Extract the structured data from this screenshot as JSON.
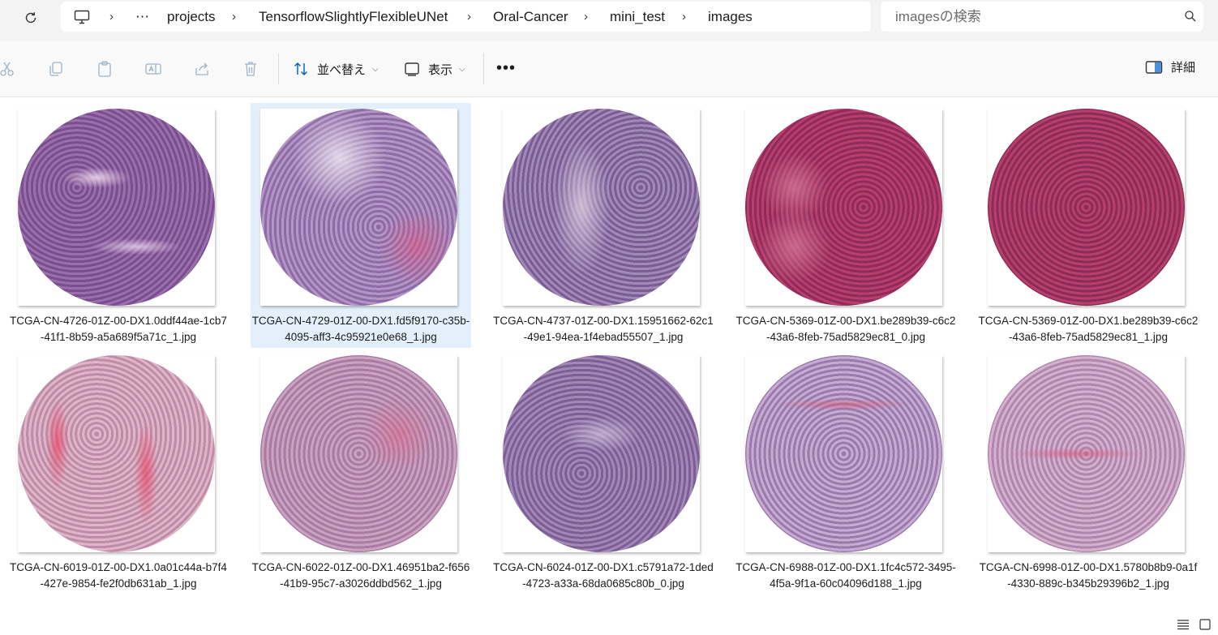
{
  "address_bar": {
    "breadcrumb": [
      {
        "label": "projects"
      },
      {
        "label": "TensorflowSlightlyFlexibleUNet"
      },
      {
        "label": "Oral-Cancer"
      },
      {
        "label": "mini_test"
      },
      {
        "label": "images"
      }
    ],
    "overflow": "⋯",
    "separator": "›"
  },
  "search": {
    "placeholder": "imagesの検索"
  },
  "toolbar": {
    "sort_label": "並べ替え",
    "view_label": "表示",
    "more": "•••",
    "details_label": "詳細"
  },
  "files": [
    {
      "name": "TCGA-CN-4726-01Z-00-DX1.0ddf44ae-1cb7-41f1-8b59-a5a689f5a71c_1.jpg",
      "selected": false
    },
    {
      "name": "TCGA-CN-4729-01Z-00-DX1.fd5f9170-c35b-4095-aff3-4c95921e0e68_1.jpg",
      "selected": true
    },
    {
      "name": "TCGA-CN-4737-01Z-00-DX1.15951662-62c1-49e1-94ea-1f4ebad55507_1.jpg",
      "selected": false
    },
    {
      "name": "TCGA-CN-5369-01Z-00-DX1.be289b39-c6c2-43a6-8feb-75ad5829ec81_0.jpg",
      "selected": false
    },
    {
      "name": "TCGA-CN-5369-01Z-00-DX1.be289b39-c6c2-43a6-8feb-75ad5829ec81_1.jpg",
      "selected": false
    },
    {
      "name": "TCGA-CN-6019-01Z-00-DX1.0a01c44a-b7f4-427e-9854-fe2f0db631ab_1.jpg",
      "selected": false
    },
    {
      "name": "TCGA-CN-6022-01Z-00-DX1.46951ba2-f656-41b9-95c7-a3026ddbd562_1.jpg",
      "selected": false
    },
    {
      "name": "TCGA-CN-6024-01Z-00-DX1.c5791a72-1ded-4723-a33a-68da0685c80b_0.jpg",
      "selected": false
    },
    {
      "name": "TCGA-CN-6988-01Z-00-DX1.1fc4c572-3495-4f5a-9f1a-60c04096d188_1.jpg",
      "selected": false
    },
    {
      "name": "TCGA-CN-6998-01Z-00-DX1.5780b8b9-0a1f-4330-889c-b345b29396b2_1.jpg",
      "selected": false
    }
  ],
  "colors": {
    "selection": "#e3f0fb",
    "toolbar_bg": "#f9f9f9",
    "address_bg": "#f3f3f3",
    "accent": "#005fb8"
  }
}
